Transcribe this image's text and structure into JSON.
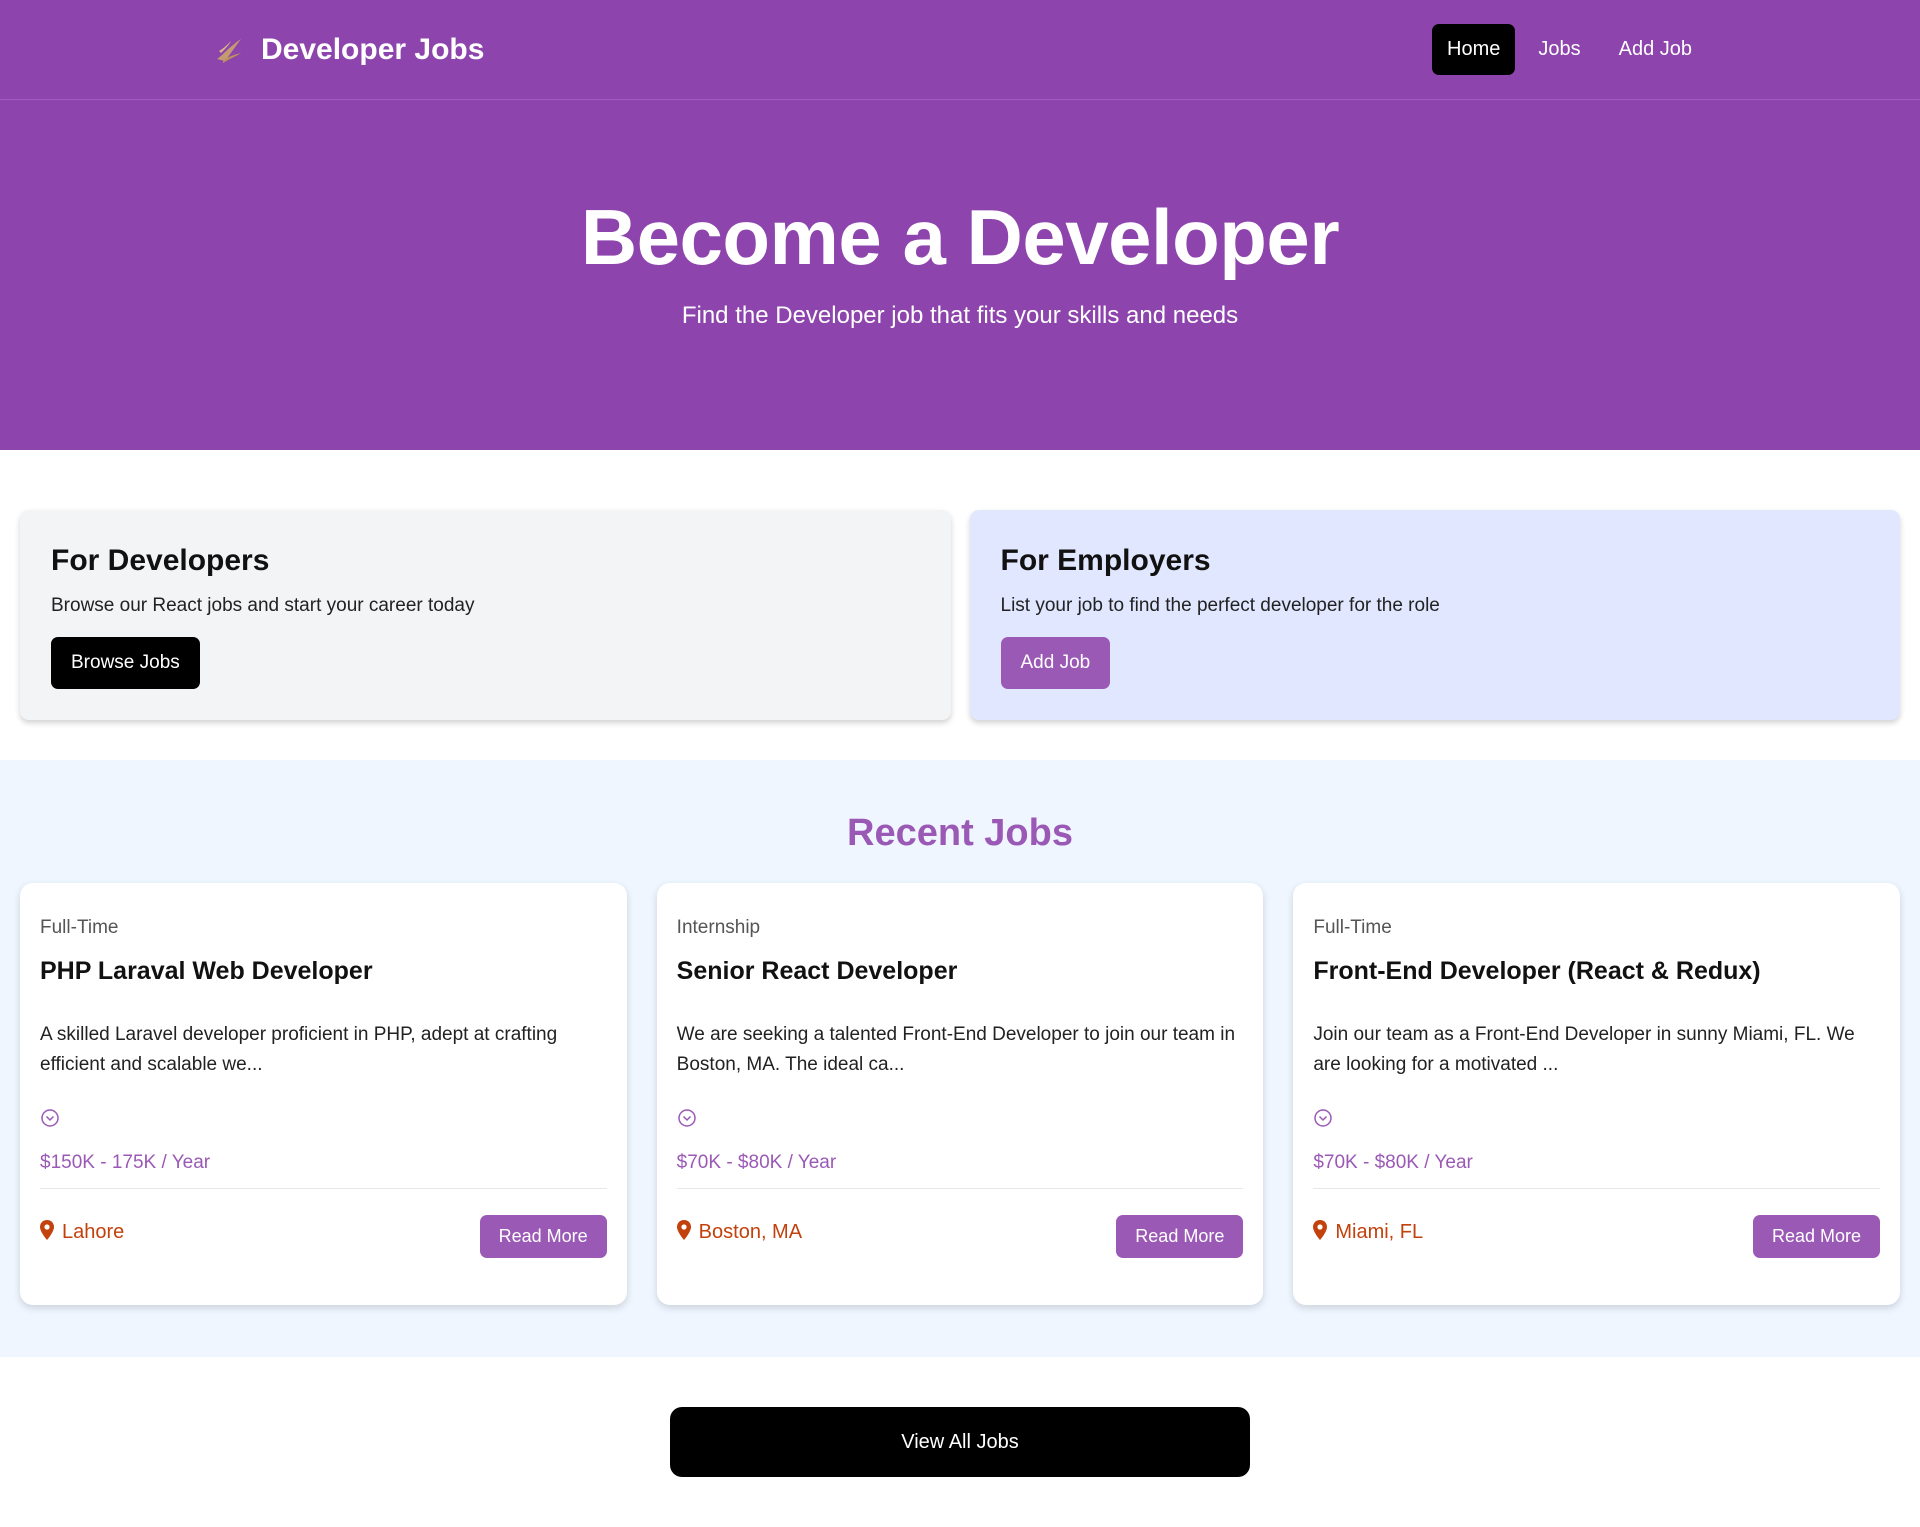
{
  "nav": {
    "brand": "Developer Jobs",
    "links": [
      {
        "label": "Home",
        "active": true
      },
      {
        "label": "Jobs",
        "active": false
      },
      {
        "label": "Add Job",
        "active": false
      }
    ]
  },
  "hero": {
    "title": "Become a Developer",
    "subtitle": "Find the Developer job that fits your skills and needs"
  },
  "cards": {
    "developers": {
      "title": "For Developers",
      "text": "Browse our React jobs and start your career today",
      "button": "Browse Jobs"
    },
    "employers": {
      "title": "For Employers",
      "text": "List your job to find the perfect developer for the role",
      "button": "Add Job"
    }
  },
  "recent": {
    "title": "Recent Jobs",
    "jobs": [
      {
        "type": "Full-Time",
        "title": "PHP Laraval Web Developer",
        "description": "A skilled Laravel developer proficient in PHP, adept at crafting efficient and scalable we...",
        "salary": "$150K - 175K / Year",
        "location": "Lahore",
        "button": "Read More"
      },
      {
        "type": "Internship",
        "title": "Senior React Developer",
        "description": "We are seeking a talented Front-End Developer to join our team in Boston, MA. The ideal ca...",
        "salary": "$70K - $80K / Year",
        "location": "Boston, MA",
        "button": "Read More"
      },
      {
        "type": "Full-Time",
        "title": "Front-End Developer (React & Redux)",
        "description": "Join our team as a Front-End Developer in sunny Miami, FL. We are looking for a motivated ...",
        "salary": "$70K - $80K / Year",
        "location": "Miami, FL",
        "button": "Read More"
      }
    ]
  },
  "view_all": "View All Jobs",
  "colors": {
    "primary": "#8e44ad",
    "accent": "#9b59b6",
    "location": "#c2410c"
  }
}
